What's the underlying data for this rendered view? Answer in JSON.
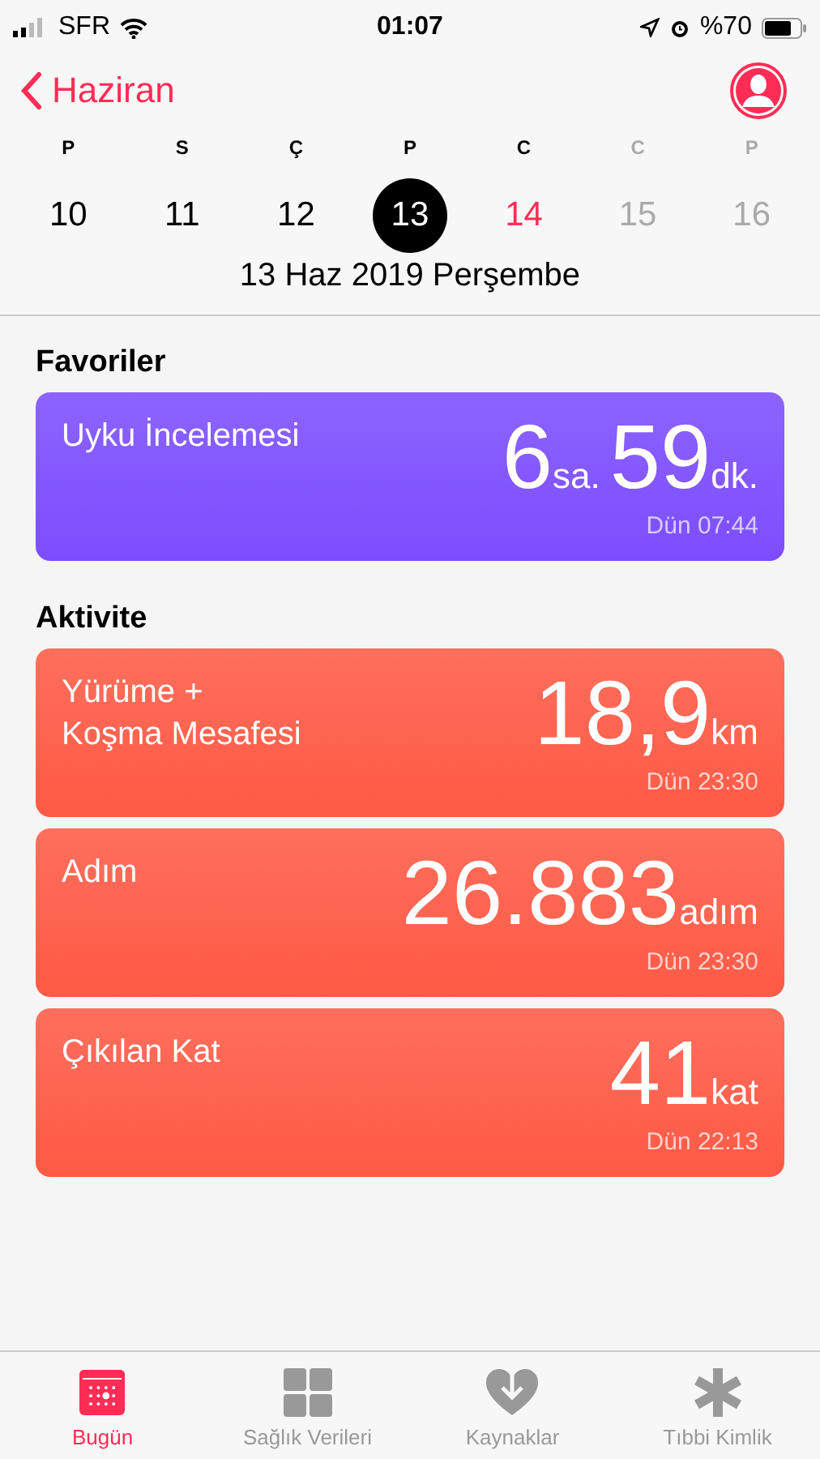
{
  "status_bar": {
    "carrier": "SFR",
    "time": "01:07",
    "battery": "%70"
  },
  "nav": {
    "back": "Haziran"
  },
  "week": [
    {
      "letter": "P",
      "day": "10",
      "kind": "past",
      "selected": false
    },
    {
      "letter": "S",
      "day": "11",
      "kind": "past",
      "selected": false
    },
    {
      "letter": "Ç",
      "day": "12",
      "kind": "past",
      "selected": false
    },
    {
      "letter": "P",
      "day": "13",
      "kind": "past",
      "selected": true
    },
    {
      "letter": "C",
      "day": "14",
      "kind": "today",
      "selected": false
    },
    {
      "letter": "C",
      "day": "15",
      "kind": "future",
      "selected": false
    },
    {
      "letter": "P",
      "day": "16",
      "kind": "future",
      "selected": false
    }
  ],
  "date_label": "13 Haz 2019 Perşembe",
  "sections": [
    {
      "title": "Favoriler",
      "cards": [
        {
          "title": "Uyku İncelemesi",
          "color": "#7c4dff",
          "parts": [
            {
              "number": "6",
              "unit": "sa."
            },
            {
              "number": "59",
              "unit": "dk."
            }
          ],
          "time": "Dün 07:44"
        }
      ]
    },
    {
      "title": "Aktivite",
      "cards": [
        {
          "title": "Yürüme +\nKoşma Mesafesi",
          "color": "#ff5a45",
          "parts": [
            {
              "number": "18,9",
              "unit": "km"
            }
          ],
          "time": "Dün 23:30"
        },
        {
          "title": "Adım",
          "color": "#ff5a45",
          "parts": [
            {
              "number": "26.883",
              "unit": "adım"
            }
          ],
          "time": "Dün 23:30"
        },
        {
          "title": "Çıkılan Kat",
          "color": "#ff5a45",
          "parts": [
            {
              "number": "41",
              "unit": "kat"
            }
          ],
          "time": "Dün 22:13"
        }
      ]
    }
  ],
  "tabs": [
    {
      "label": "Bugün",
      "kind": "today",
      "selected": true
    },
    {
      "label": "Sağlık Verileri",
      "kind": "data",
      "selected": false
    },
    {
      "label": "Kaynaklar",
      "kind": "sources",
      "selected": false
    },
    {
      "label": "Tıbbi Kimlik",
      "kind": "medical",
      "selected": false
    }
  ]
}
